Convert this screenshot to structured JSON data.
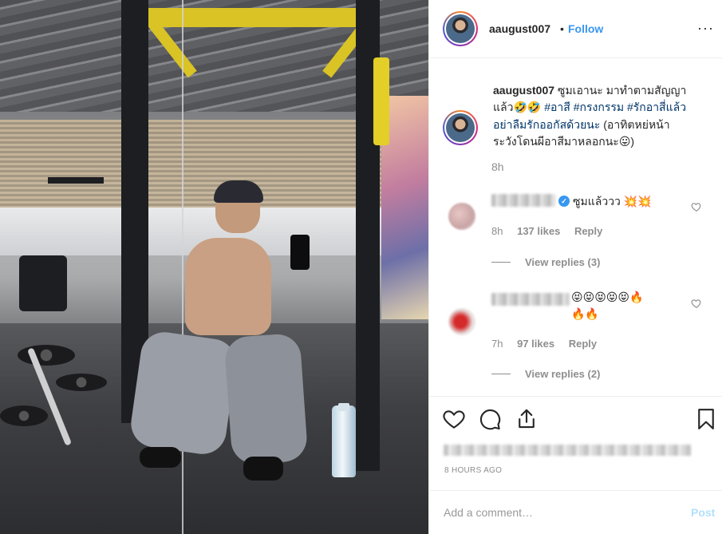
{
  "post": {
    "username": "aaugust007",
    "separator": "•",
    "follow_label": "Follow",
    "more_icon": "···"
  },
  "caption": {
    "username": "aaugust007",
    "text_1": " ซูมเอานะ มาทำตามสัญญา",
    "text_2": "แล้ว",
    "emoji_1": "🤣🤣",
    "tag_1": "#อาสี",
    "tag_2": "#กรงกรรม",
    "tag_3": "#รักอาสี่แล้ว",
    "tag_4": "อย่าลืมรักออกัสด้วยนะ",
    "text_3": " (อาทิตหย่หน้า",
    "text_4": "ระวังโดนผีอาสีมาหลอกนะ",
    "emoji_2": "😛",
    "text_5": ")",
    "time": "8h"
  },
  "comments": [
    {
      "text": "ซูมแล้ววว ",
      "emoji": "💥💥",
      "time": "8h",
      "likes": "137 likes",
      "reply_label": "Reply",
      "view_replies": "View replies (3)"
    },
    {
      "emoji_line_1": "😝😝😝😝😝🔥",
      "emoji_line_2": "🔥🔥",
      "time": "7h",
      "likes": "97 likes",
      "reply_label": "Reply",
      "view_replies": "View replies (2)"
    }
  ],
  "actions": {
    "like_icon": "heart-icon",
    "comment_icon": "comment-icon",
    "share_icon": "share-icon",
    "save_icon": "bookmark-icon"
  },
  "posted_ago": "8 HOURS AGO",
  "comment_box": {
    "placeholder": "Add a comment…",
    "post_label": "Post"
  },
  "colors": {
    "link": "#3897f0",
    "hashtag": "#003569",
    "muted": "#8e8e8e",
    "post_disabled": "#b2dffc"
  }
}
